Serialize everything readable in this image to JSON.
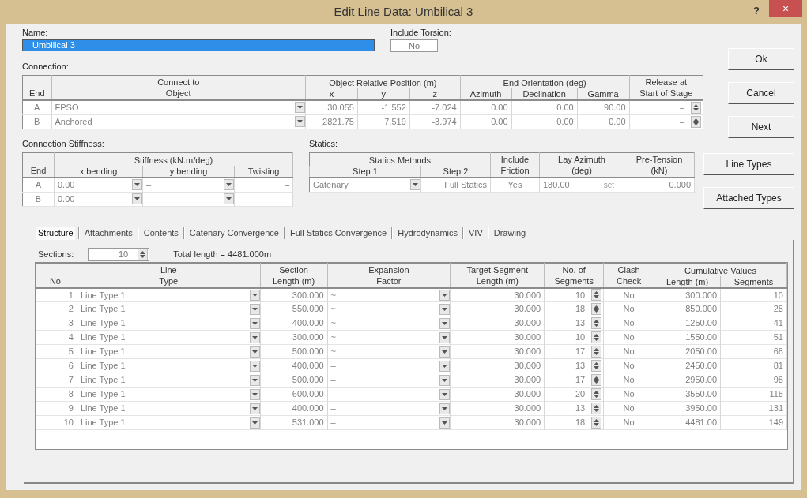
{
  "window": {
    "title": "Edit Line Data: Umbilical 3",
    "help": "?",
    "close": "×"
  },
  "name": {
    "label": "Name:",
    "value": "Umbilical 3"
  },
  "torsion": {
    "label": "Include Torsion:",
    "value": "No"
  },
  "buttons": [
    "Ok",
    "Cancel",
    "Next",
    "Line Types",
    "Attached Types"
  ],
  "connection": {
    "label": "Connection:",
    "columns": [
      {
        "label": "End",
        "kind": "center"
      },
      {
        "label": "Connect to\nObject",
        "kind": "dropdown"
      },
      {
        "group": "Object Relative Position (m)",
        "colspan": 3,
        "columns": [
          {
            "label": "x",
            "kind": "number"
          },
          {
            "label": "y",
            "kind": "number"
          },
          {
            "label": "z",
            "kind": "number"
          }
        ]
      },
      {
        "group": "End Orientation (deg)",
        "colspan": 3,
        "columns": [
          {
            "label": "Azimuth",
            "kind": "number"
          },
          {
            "label": "Declination",
            "kind": "number"
          },
          {
            "label": "Gamma",
            "kind": "number"
          }
        ]
      },
      {
        "label": "Release at\nStart of Stage",
        "kind": "spinner"
      }
    ],
    "rows": [
      [
        "A",
        "FPSO",
        "30.055",
        "-1.552",
        "-7.024",
        "0.00",
        "0.00",
        "90.00",
        "–"
      ],
      [
        "B",
        "Anchored",
        "2821.75",
        "7.519",
        "-3.974",
        "0.00",
        "0.00",
        "0.00",
        "–"
      ]
    ]
  },
  "stiffness": {
    "label": "Connection Stiffness:",
    "columns": [
      {
        "label": "End",
        "kind": "center"
      },
      {
        "group": "Stiffness (kN.m/deg)",
        "colspan": 3,
        "columns": [
          {
            "label": "x bending",
            "kind": "dropdown"
          },
          {
            "label": "y bending",
            "kind": "dropdown"
          },
          {
            "label": "Twisting",
            "kind": "number"
          }
        ]
      }
    ],
    "rows": [
      [
        "A",
        "0.00",
        "–",
        "–"
      ],
      [
        "B",
        "0.00",
        "–",
        "–"
      ]
    ]
  },
  "statics": {
    "label": "Statics:",
    "columns": [
      {
        "group": "Statics Methods",
        "colspan": 2,
        "columns": [
          {
            "label": "Step 1",
            "kind": "dropdown"
          },
          {
            "label": "Step 2",
            "kind": "number"
          }
        ]
      },
      {
        "label": "Include\nFriction",
        "kind": "center"
      },
      {
        "label": "Lay Azimuth\n(deg)",
        "kind": "set"
      },
      {
        "label": "Pre-Tension\n(kN)",
        "kind": "number"
      }
    ],
    "rows": [
      [
        "Catenary",
        "Full Statics",
        "Yes",
        [
          "180.00",
          "set"
        ],
        "0.000"
      ]
    ]
  },
  "tabs": [
    {
      "label": "Structure",
      "selected": true
    },
    {
      "label": "Attachments",
      "selected": false
    },
    {
      "label": "Contents",
      "selected": false
    },
    {
      "label": "Catenary Convergence",
      "selected": false
    },
    {
      "label": "Full Statics Convergence",
      "selected": false
    },
    {
      "label": "Hydrodynamics",
      "selected": false
    },
    {
      "label": "VIV",
      "selected": false
    },
    {
      "label": "Drawing",
      "selected": false
    }
  ],
  "sections": {
    "label": "Sections:",
    "value": "10",
    "total": "Total length = 4481.000m"
  },
  "structure": {
    "columns": [
      {
        "label": "No.",
        "kind": "number"
      },
      {
        "label": "Line\nType",
        "kind": "dropdown"
      },
      {
        "label": "Section\nLength (m)",
        "kind": "number"
      },
      {
        "label": "Expansion\nFactor",
        "kind": "dropdown"
      },
      {
        "label": "Target Segment\nLength (m)",
        "kind": "number"
      },
      {
        "label": "No. of\nSegments",
        "kind": "spinner"
      },
      {
        "label": "Clash\nCheck",
        "kind": "center"
      },
      {
        "group": "Cumulative Values",
        "colspan": 2,
        "columns": [
          {
            "label": "Length (m)",
            "kind": "number"
          },
          {
            "label": "Segments",
            "kind": "number"
          }
        ]
      }
    ],
    "rows": [
      [
        "1",
        "Line Type 1",
        "300.000",
        "~",
        "30.000",
        "10",
        "No",
        "300.000",
        "10"
      ],
      [
        "2",
        "Line Type 1",
        "550.000",
        "~",
        "30.000",
        "18",
        "No",
        "850.000",
        "28"
      ],
      [
        "3",
        "Line Type 1",
        "400.000",
        "~",
        "30.000",
        "13",
        "No",
        "1250.00",
        "41"
      ],
      [
        "4",
        "Line Type 1",
        "300.000",
        "~",
        "30.000",
        "10",
        "No",
        "1550.00",
        "51"
      ],
      [
        "5",
        "Line Type 1",
        "500.000",
        "~",
        "30.000",
        "17",
        "No",
        "2050.00",
        "68"
      ],
      [
        "6",
        "Line Type 1",
        "400.000",
        "–",
        "30.000",
        "13",
        "No",
        "2450.00",
        "81"
      ],
      [
        "7",
        "Line Type 1",
        "500.000",
        "–",
        "30.000",
        "17",
        "No",
        "2950.00",
        "98"
      ],
      [
        "8",
        "Line Type 1",
        "600.000",
        "–",
        "30.000",
        "20",
        "No",
        "3550.00",
        "118"
      ],
      [
        "9",
        "Line Type 1",
        "400.000",
        "–",
        "30.000",
        "13",
        "No",
        "3950.00",
        "131"
      ],
      [
        "10",
        "Line Type 1",
        "531.000",
        "–",
        "30.000",
        "18",
        "No",
        "4481.00",
        "149"
      ]
    ]
  }
}
